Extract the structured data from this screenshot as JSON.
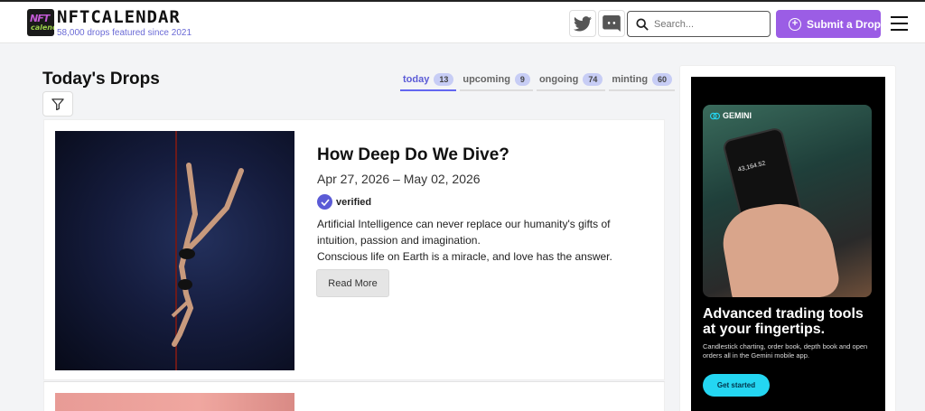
{
  "header": {
    "logo_top": "NFT",
    "logo_bottom": "calendar",
    "brand": "NFTCALENDAR",
    "tagline": "58,000 drops featured since 2021",
    "search_placeholder": "Search...",
    "submit_label": "Submit a Drop"
  },
  "page": {
    "title": "Today's Drops"
  },
  "tabs": [
    {
      "label": "today",
      "count": "13"
    },
    {
      "label": "upcoming",
      "count": "9"
    },
    {
      "label": "ongoing",
      "count": "74"
    },
    {
      "label": "minting",
      "count": "60"
    }
  ],
  "drops": [
    {
      "title": "How Deep Do We Dive?",
      "dates": "Apr 27, 2026 – May 02, 2026",
      "verified_label": "verified",
      "desc_line1": "Artificial Intelligence can never replace our humanity's gifts of intuition, passion and imagination.",
      "desc_line2": "Conscious life on Earth is a miracle, and love has the answer.",
      "read_more": "Read More"
    }
  ],
  "ad": {
    "brand": "GEMINI",
    "screen_value": "43,164.52",
    "headline": "Advanced trading tools at your fingertips.",
    "subtext": "Candlestick charting, order book, depth book and open orders all in the Gemini mobile app.",
    "cta": "Get started"
  },
  "colors": {
    "accent": "#9b5de5",
    "tab_active": "#6366f1",
    "verified": "#5b5bd6",
    "ad_cta": "#24d6f2"
  }
}
